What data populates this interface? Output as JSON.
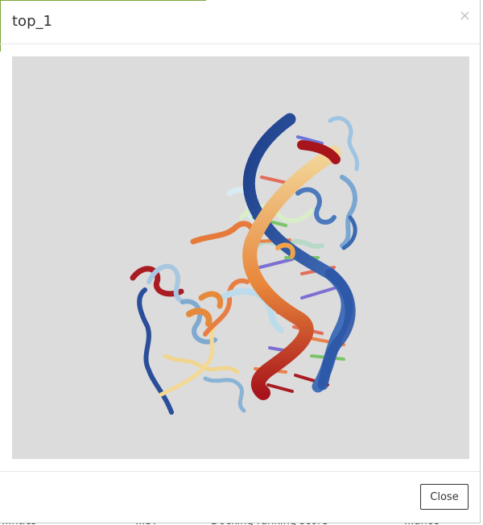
{
  "modal": {
    "title": "top_1",
    "close_glyph": "×",
    "close_button_label": "Close"
  },
  "viewer": {
    "content": "molecular-structure-rendering",
    "background": "#dcdcdc"
  },
  "background_table_partial": [
    "...ntics",
    "...S7",
    "Docking ranking score",
    "...ance"
  ],
  "colors": {
    "accent": "#7aa63c",
    "dna_blue": "#2f5fa8",
    "dna_orange": "#e8863a",
    "dna_red": "#a8141c",
    "protein_lightblue": "#b7d5ea",
    "protein_orange": "#e27a3e"
  }
}
